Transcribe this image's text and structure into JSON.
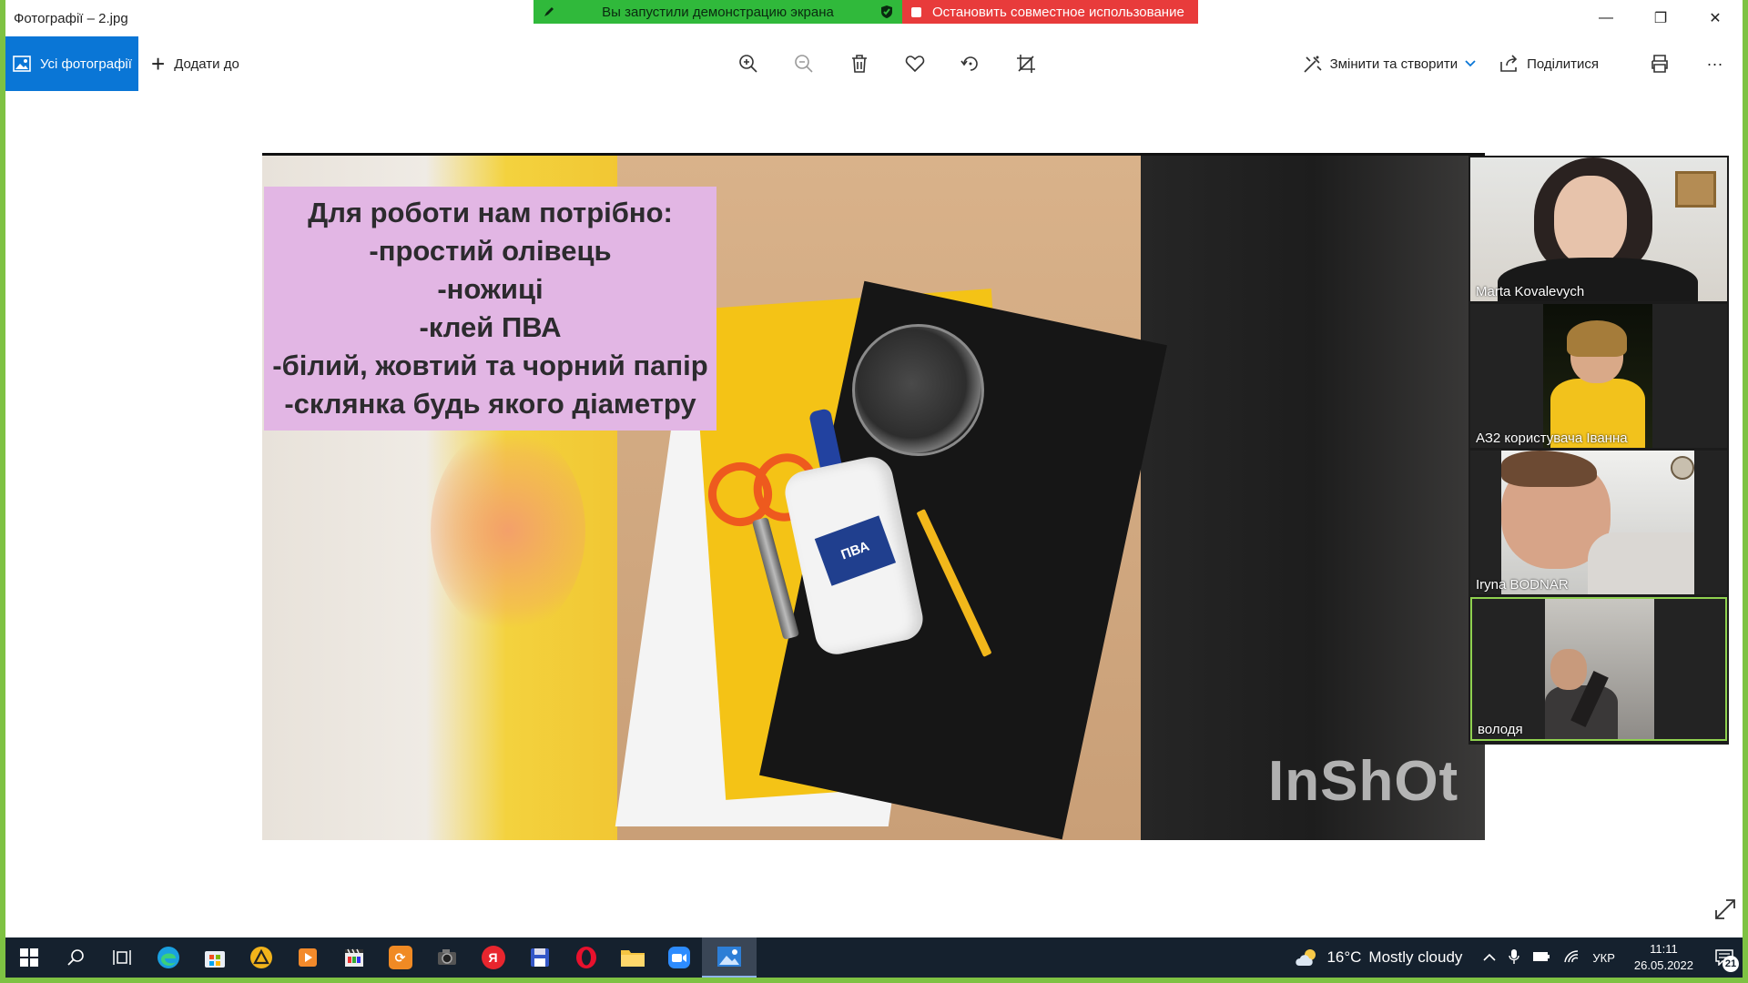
{
  "window": {
    "title": "Фотографії – 2.jpg",
    "minimize_glyph": "—",
    "maximize_glyph": "❐",
    "close_glyph": "✕"
  },
  "share_banner": {
    "status_text": "Вы запустили демонстрацию экрана",
    "stop_text": "Остановить совместное использование",
    "status_color": "#30b93b",
    "stop_color": "#e83b3b"
  },
  "toolbar": {
    "all_photos_label": "Усі фотографії",
    "add_to_label": "Додати до",
    "edit_create_label": "Змінити та створити",
    "share_label": "Поділитися",
    "tools": [
      "zoom-in-icon",
      "zoom-out-icon",
      "delete-icon",
      "favorite-icon",
      "rotate-icon",
      "crop-icon"
    ],
    "more_glyph": "···"
  },
  "photo": {
    "card_lines": [
      "Для роботи нам потрібно:",
      "-простий олівець",
      "-ножиці",
      "-клей ПВА",
      "-білий, жовтий та чорний папір",
      "-склянка будь якого діаметру"
    ],
    "glue_label": "ПВА",
    "watermark": "InShOt"
  },
  "participants": [
    {
      "name": "Marta Kovalevych",
      "active": false
    },
    {
      "name": "АЗ2 користувача Іванна",
      "active": false
    },
    {
      "name": "Iryna BODNAR",
      "active": false
    },
    {
      "name": "володя",
      "active": true
    }
  ],
  "taskbar": {
    "apps": [
      "start-icon",
      "search-icon",
      "task-view-icon",
      "edge-icon",
      "store-icon",
      "app-triangle-icon",
      "media-player-icon",
      "video-editor-icon",
      "pdf-icon",
      "camera-app-icon",
      "yandex-icon",
      "floppy-app-icon",
      "opera-icon",
      "file-explorer-icon",
      "zoom-icon",
      "photos-icon"
    ],
    "yandex_letter": "Я",
    "weather_temp": "16°C",
    "weather_text": "Mostly cloudy",
    "language": "УКР",
    "time": "11:11",
    "date": "26.05.2022",
    "notification_count": "21",
    "accent_color": "#7ec243"
  }
}
